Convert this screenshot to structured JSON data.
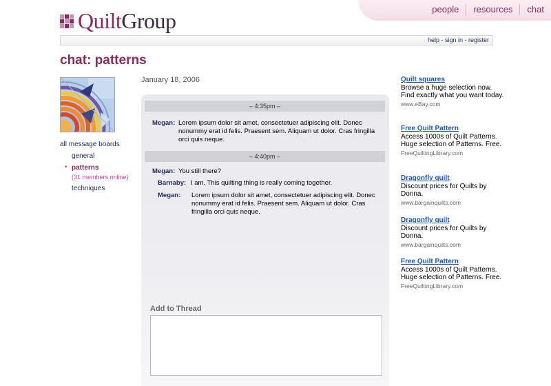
{
  "brand": {
    "logo_prefix": "Quilt",
    "logo_suffix": "Group",
    "accent_color": "#8a2a5e"
  },
  "topnav": [
    "people",
    "resources",
    "chat"
  ],
  "utility_links": {
    "help": "help",
    "sep1": " - ",
    "signin": "sign in",
    "sep2": " - ",
    "register": "register"
  },
  "page_title": "chat: patterns",
  "sidebar": {
    "all_label": "all message boards",
    "boards": [
      {
        "label": "general",
        "active": false
      },
      {
        "label": "patterns",
        "active": true,
        "members": "(31 members online)"
      },
      {
        "label": "techniques",
        "active": false
      }
    ]
  },
  "thread": {
    "date": "January 18, 2006",
    "groups": [
      {
        "time": "– 4:35pm –",
        "messages": [
          {
            "author": "Megan:",
            "text": "Lorem ipsum dolor sit amet, consectetuer adipiscing elit. Donec nonummy erat id felis. Praesent sem. Aliquam ut dolor. Cras fringilla orci quis neque."
          }
        ]
      },
      {
        "time": "– 4:40pm –",
        "messages": [
          {
            "author": "Megan:",
            "text": "You still there?"
          },
          {
            "author": "Barnaby:",
            "text": "I am. This quilting thing is really coming together."
          },
          {
            "author": "Megan:",
            "text": "Lorem ipsum dolor sit amet, consectetuer adipiscing elit. Donec nonummy erat id felis. Praesent sem. Aliquam ut dolor. Cras fringilla orci quis neque."
          }
        ]
      }
    ],
    "add_label": "Add to Thread",
    "reply_value": ""
  },
  "ads": [
    {
      "title": "Quilt squares",
      "desc": "Browse a huge selection now. Find exactly what you want today.",
      "url": "www.eBay.com"
    },
    {
      "title": "Free Quilt Pattern",
      "desc": "Access 1000s of Quilt Patterns. Huge selection of Patterns. Free.",
      "url": "FreeQuiltingLibrary.com"
    },
    {
      "title": "Dragonfly quilt",
      "desc": "Discount prices for Quilts by Donna.",
      "url": "www.bargainquilts.com"
    },
    {
      "title": "Dragonfly quilt",
      "desc": "Discount prices for Quilts by Donna.",
      "url": "www.bargainquilts.com"
    },
    {
      "title": "Free Quilt Pattern",
      "desc": "Access 1000s of Quilt Patterns. Huge selection of Patterns. Free.",
      "url": "FreeQuiltingLibrary.com"
    }
  ]
}
